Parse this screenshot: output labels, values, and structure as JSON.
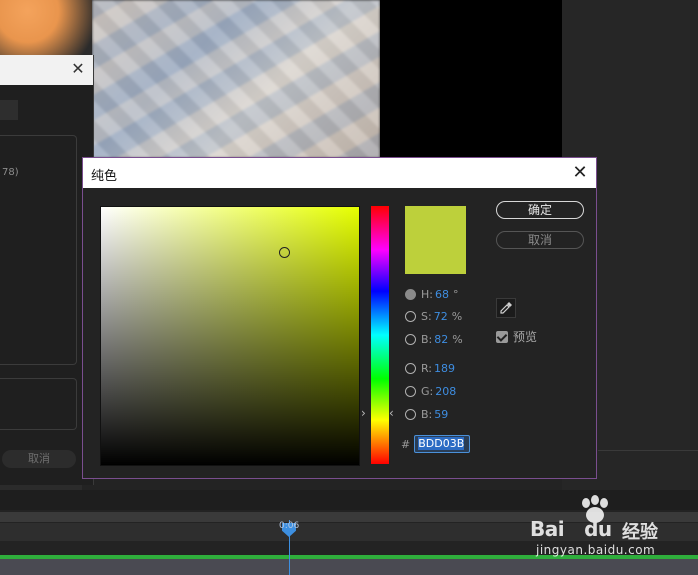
{
  "dialog": {
    "title": "纯色",
    "close_icon": "close-icon",
    "ok_label": "确定",
    "cancel_label": "取消",
    "preview_label": "预览",
    "preview_checked": true,
    "swatch_color": "#BDD03B",
    "hue_base_color": "#E6FF00",
    "hsb": {
      "h": {
        "label": "H:",
        "value": "68",
        "unit": "°"
      },
      "s": {
        "label": "S:",
        "value": "72",
        "unit": "%"
      },
      "b": {
        "label": "B:",
        "value": "82",
        "unit": "%"
      }
    },
    "rgb": {
      "r": {
        "label": "R:",
        "value": "189"
      },
      "g": {
        "label": "G:",
        "value": "208"
      },
      "b": {
        "label": "B:",
        "value": "59"
      }
    },
    "hex_prefix": "#",
    "hex_value": "BDD03B",
    "selected_mode": "H",
    "eyedropper_icon": "eyedropper-icon"
  },
  "background_dialog": {
    "partial_text": "78)",
    "cancel_label": "取消"
  },
  "timeline": {
    "playhead_label": "0:06",
    "accent_color": "#3D8FE0",
    "track_color": "#2FAE3C"
  },
  "watermark": {
    "logo": "Bai",
    "logo_suffix": "du",
    "logo_cn": "经验",
    "url": "jingyan.baidu.com"
  }
}
